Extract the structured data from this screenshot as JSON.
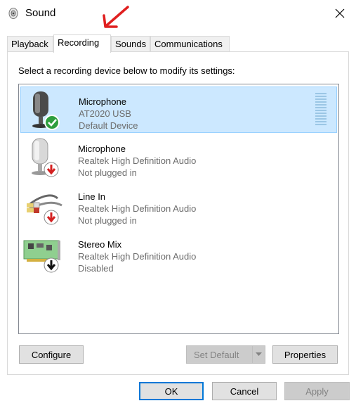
{
  "window": {
    "title": "Sound",
    "close_icon": "close-icon"
  },
  "tabs": [
    {
      "label": "Playback",
      "active": false
    },
    {
      "label": "Recording",
      "active": true
    },
    {
      "label": "Sounds",
      "active": false
    },
    {
      "label": "Communications",
      "active": false
    }
  ],
  "annotation": {
    "icon": "red-arrow-pointing-to-recording-tab",
    "color": "#e02020"
  },
  "instruction": "Select a recording device below to modify its settings:",
  "devices": [
    {
      "name": "Microphone",
      "detail": "AT2020 USB",
      "status": "Default Device",
      "icon": "microphone-icon",
      "badge": "green-check",
      "selected": true,
      "badge_color": "#2e9e3e"
    },
    {
      "name": "Microphone",
      "detail": "Realtek High Definition Audio",
      "status": "Not plugged in",
      "icon": "microphone-icon",
      "badge": "red-down-arrow",
      "selected": false,
      "badge_color": "#d32020"
    },
    {
      "name": "Line In",
      "detail": "Realtek High Definition Audio",
      "status": "Not plugged in",
      "icon": "line-in-cable-icon",
      "badge": "red-down-arrow",
      "selected": false,
      "badge_color": "#d32020"
    },
    {
      "name": "Stereo Mix",
      "detail": "Realtek High Definition Audio",
      "status": "Disabled",
      "icon": "sound-card-icon",
      "badge": "black-down-arrow",
      "selected": false,
      "badge_color": "#111111"
    }
  ],
  "buttons": {
    "configure": "Configure",
    "set_default": "Set Default",
    "properties": "Properties",
    "ok": "OK",
    "cancel": "Cancel",
    "apply": "Apply"
  },
  "colors": {
    "selection_bg": "#cce8ff",
    "selection_border": "#99d1ff",
    "accent": "#0078d7"
  }
}
